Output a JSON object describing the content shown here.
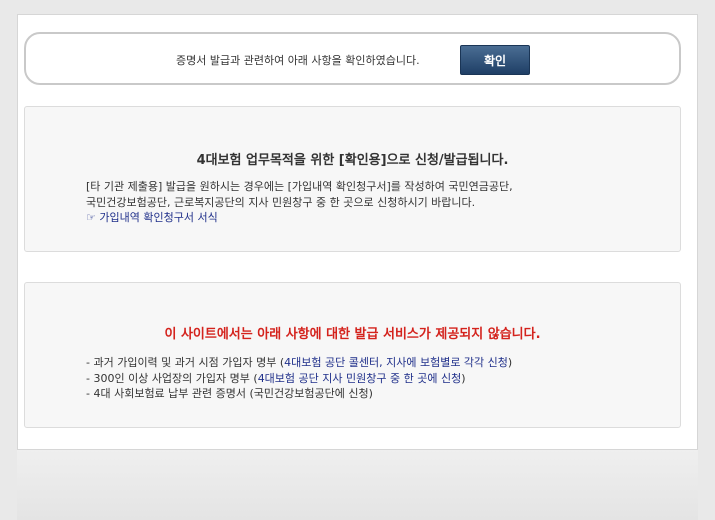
{
  "confirm": {
    "text": "증명서 발급과 관련하여 아래 사항을 확인하였습니다.",
    "button_label": "확인"
  },
  "panel1": {
    "title": "4대보험 업무목적을 위한 [확인용]으로 신청/발급됩니다.",
    "line1": "[타 기관 제출용] 발급을 원하시는 경우에는 [가입내역 확인청구서]를 작성하여 국민연금공단,",
    "line2": "국민건강보험공단, 근로복지공단의 지사 민원창구 중 한 곳으로 신청하시기 바랍니다.",
    "link_icon": "☞",
    "link_label": "가입내역 확인청구서 서식"
  },
  "panel2": {
    "title": "이 사이트에서는 아래 사항에 대한 발급 서비스가 제공되지 않습니다.",
    "items": [
      {
        "prefix": "- 과거 가입이력 및 과거 시점 가입자 명부 (",
        "highlight": "4대보험 공단 콜센터, 지사에 보험별로 각각 신청",
        "suffix": ")"
      },
      {
        "prefix": "- 300인 이상 사업장의 가입자 명부 (",
        "highlight": "4대보험 공단 지사 민원창구 중 한 곳에 신청",
        "suffix": ")"
      },
      {
        "prefix": "- 4대 사회보험료 납부 관련 증명서 (국민건강보험공단에 신청)",
        "highlight": "",
        "suffix": ""
      }
    ]
  }
}
